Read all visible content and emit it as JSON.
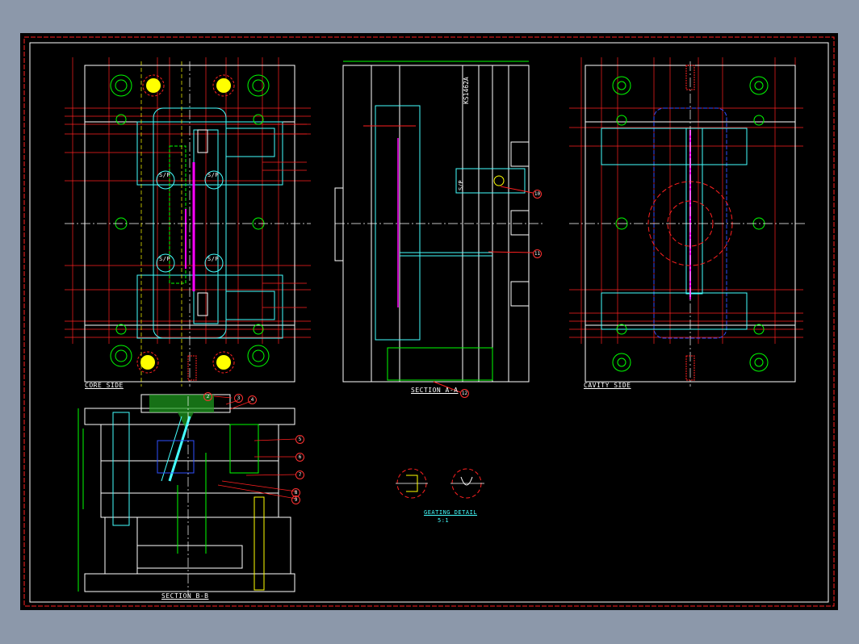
{
  "colors": {
    "background_window": "#8c98aa",
    "background_drawing": "#000000",
    "border": "#ff2020",
    "plate": "#ffffff",
    "cyan": "#00ffff",
    "red": "#ff2020",
    "green": "#00ff00",
    "yellow": "#ffff00",
    "magenta": "#ff00ff",
    "blue": "#3050ff"
  },
  "views": {
    "core_side": "CORE SIDE",
    "section_aa": "SECTION A-A",
    "cavity_side": "CAVITY SIDE",
    "section_bb": "SECTION B-B",
    "gating_detail": "GEATING DETAIL",
    "gating_scale": "5:1"
  },
  "section_aa_part_number": "KS1462A",
  "balloons": [
    "2",
    "3",
    "4",
    "5",
    "6",
    "7",
    "8",
    "9",
    "10",
    "11",
    "12"
  ],
  "marks": {
    "sp": "S/P"
  }
}
